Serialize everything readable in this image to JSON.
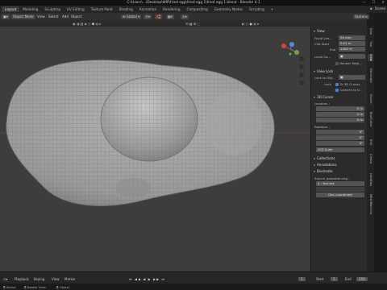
{
  "window": {
    "title": "C:\\Users\\...\\Desktop\\WIP\\fried egg\\fried egg 1\\fried egg 1.blend - Blender 4.1"
  },
  "workspace_tabs": [
    "Layout",
    "Modeling",
    "Sculpting",
    "UV Editing",
    "Texture Paint",
    "Shading",
    "Animation",
    "Rendering",
    "Compositing",
    "Geometry Nodes",
    "Scripting",
    "+"
  ],
  "scene_label": "Scene",
  "viewport_header": {
    "mode": "Object Mode",
    "view": "View",
    "select": "Select",
    "add": "Add",
    "object": "Object",
    "transform": "Global",
    "options": "Options"
  },
  "npanel": {
    "view_section": "View",
    "focal_length_label": "Focal Len...",
    "focal_length": "50 mm",
    "clip_start_label": "Clip Start",
    "clip_start": "0.01 m",
    "clip_end_label": "End",
    "clip_end": "1000 m",
    "local_camera_label": "Local Ca...",
    "render_region_label": "Render Regi...",
    "view_lock_section": "View Lock",
    "lock_to_object_label": "Lock to Obj...",
    "lock_label": "Lock",
    "to_3d_cursor": "To 3D Cursor",
    "camera_to_view": "Camera to V...",
    "cursor_section": "3D Cursor",
    "location_label": "Location :",
    "loc_x": "0 m",
    "loc_y": "0 m",
    "loc_z": "0 m",
    "rotation_label": "Rotation :",
    "rot_x": "0°",
    "rot_y": "0°",
    "rot_z": "0°",
    "rotation_mode": "XYZ Euler",
    "collections_section": "Collections",
    "annotations_section": "Annotations",
    "decimate_section": "Decimate",
    "source_label": "Source (possible orig...",
    "not_set": "0 - Not set",
    "gen_coordinate_button": "Gen coordinate"
  },
  "vertical_tabs": [
    "Item",
    "Tool",
    "View",
    "Decimate",
    "Fluent",
    "BoxCutter",
    "Edit",
    "Create",
    "HardOps",
    "MeshMachine"
  ],
  "timeline": {
    "playback": "Playback",
    "keying": "Keying",
    "view": "View",
    "marker": "Marker",
    "current_frame": "1",
    "start_label": "Start",
    "start": "1",
    "end_label": "End",
    "end": "250"
  },
  "statusbar": {
    "left": "Select",
    "middle": "Rotate View",
    "right": "Object"
  },
  "colors": {
    "accent": "#4a7fc9",
    "viewport_bg": "#3d3d3d",
    "mesh": "#a9a9a9",
    "panel_bg": "#2b2b2b"
  }
}
